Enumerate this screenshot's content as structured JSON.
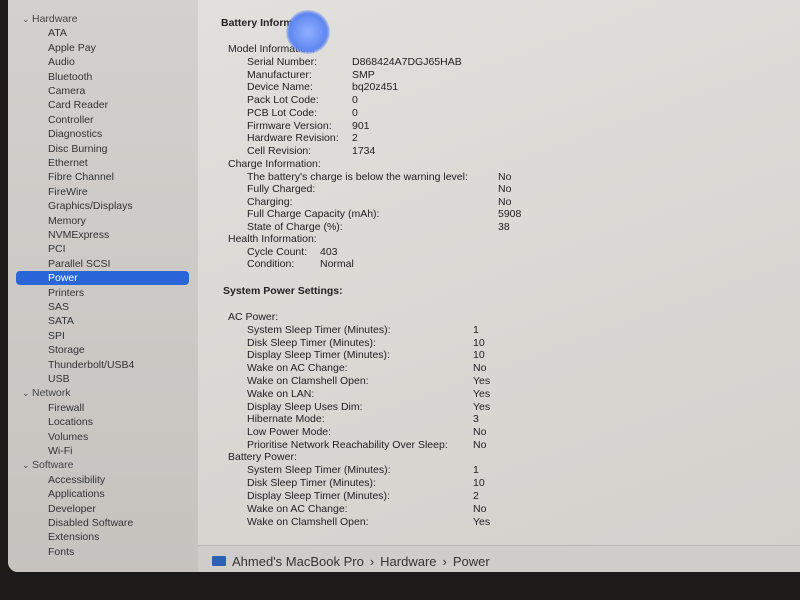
{
  "sidebar": {
    "groups": [
      {
        "label": "Hardware",
        "items": [
          "ATA",
          "Apple Pay",
          "Audio",
          "Bluetooth",
          "Camera",
          "Card Reader",
          "Controller",
          "Diagnostics",
          "Disc Burning",
          "Ethernet",
          "Fibre Channel",
          "FireWire",
          "Graphics/Displays",
          "Memory",
          "NVMExpress",
          "PCI",
          "Parallel SCSI",
          "Power",
          "Printers",
          "SAS",
          "SATA",
          "SPI",
          "Storage",
          "Thunderbolt/USB4",
          "USB"
        ]
      },
      {
        "label": "Network",
        "items": [
          "Firewall",
          "Locations",
          "Volumes",
          "Wi-Fi"
        ]
      },
      {
        "label": "Software",
        "items": [
          "Accessibility",
          "Applications",
          "Developer",
          "Disabled Software",
          "Extensions",
          "Fonts"
        ]
      }
    ],
    "selected": "Power"
  },
  "main": {
    "title": "Battery Information:",
    "model": {
      "label": "Model Information:",
      "rows": [
        [
          "Serial Number:",
          "D868424A7DGJ65HAB"
        ],
        [
          "Manufacturer:",
          "SMP"
        ],
        [
          "Device Name:",
          "bq20z451"
        ],
        [
          "Pack Lot Code:",
          "0"
        ],
        [
          "PCB Lot Code:",
          "0"
        ],
        [
          "Firmware Version:",
          "901"
        ],
        [
          "Hardware Revision:",
          "2"
        ],
        [
          "Cell Revision:",
          "1734"
        ]
      ]
    },
    "charge": {
      "label": "Charge Information:",
      "rows": [
        [
          "The battery's charge is below the warning level:",
          "No"
        ],
        [
          "Fully Charged:",
          "No"
        ],
        [
          "Charging:",
          "No"
        ],
        [
          "Full Charge Capacity (mAh):",
          "5908"
        ],
        [
          "State of Charge (%):",
          "38"
        ]
      ]
    },
    "health": {
      "label": "Health Information:",
      "rows": [
        [
          "Cycle Count:",
          "403"
        ],
        [
          "Condition:",
          "Normal"
        ]
      ]
    },
    "power_title": "System Power Settings:",
    "ac": {
      "label": "AC Power:",
      "rows": [
        [
          "System Sleep Timer (Minutes):",
          "1"
        ],
        [
          "Disk Sleep Timer (Minutes):",
          "10"
        ],
        [
          "Display Sleep Timer (Minutes):",
          "10"
        ],
        [
          "Wake on AC Change:",
          "No"
        ],
        [
          "Wake on Clamshell Open:",
          "Yes"
        ],
        [
          "Wake on LAN:",
          "Yes"
        ],
        [
          "Display Sleep Uses Dim:",
          "Yes"
        ],
        [
          "Hibernate Mode:",
          "3"
        ],
        [
          "Low Power Mode:",
          "No"
        ],
        [
          "Prioritise Network Reachability Over Sleep:",
          "No"
        ]
      ]
    },
    "battery": {
      "label": "Battery Power:",
      "rows": [
        [
          "System Sleep Timer (Minutes):",
          "1"
        ],
        [
          "Disk Sleep Timer (Minutes):",
          "10"
        ],
        [
          "Display Sleep Timer (Minutes):",
          "2"
        ],
        [
          "Wake on AC Change:",
          "No"
        ],
        [
          "Wake on Clamshell Open:",
          "Yes"
        ]
      ]
    }
  },
  "pathbar": {
    "computer": "Ahmed's MacBook Pro",
    "sep": "›",
    "section": "Hardware",
    "item": "Power"
  },
  "colors": {
    "selection": "#2b66d8"
  }
}
